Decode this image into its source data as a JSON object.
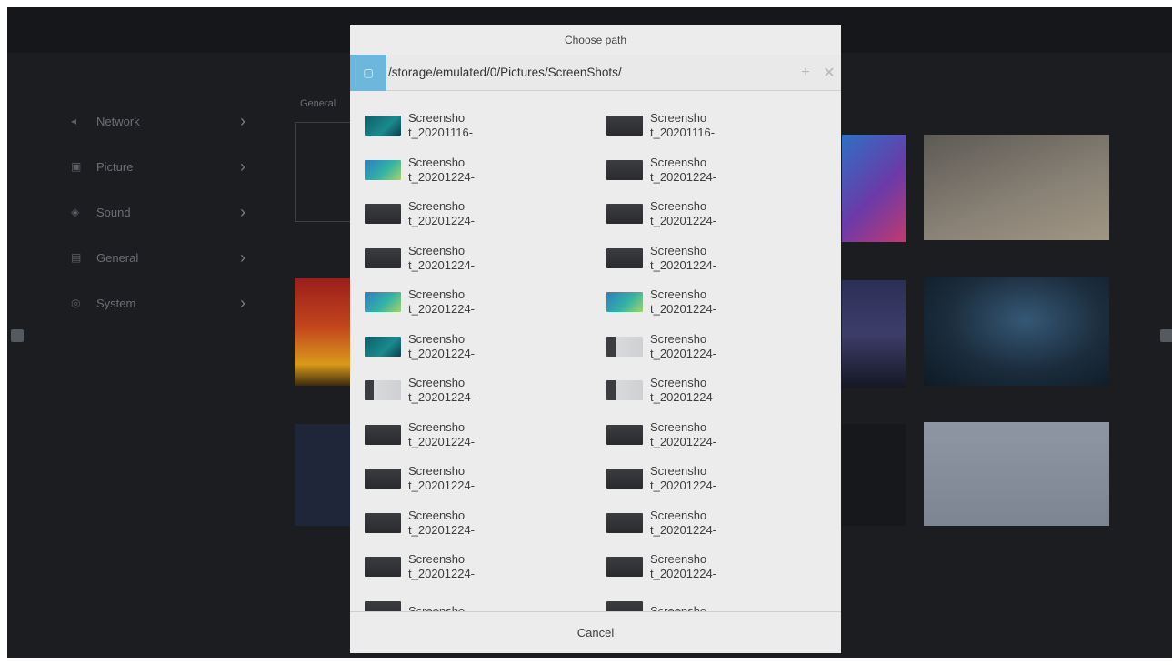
{
  "settings": {
    "nav_items": [
      {
        "label": "Network",
        "icon": "network-icon"
      },
      {
        "label": "Picture",
        "icon": "picture-icon"
      },
      {
        "label": "Sound",
        "icon": "sound-icon"
      },
      {
        "label": "General",
        "icon": "general-icon"
      },
      {
        "label": "System",
        "icon": "system-icon"
      }
    ],
    "section_label": "General",
    "chevron": "›"
  },
  "dialog": {
    "title": "Choose path",
    "path": "/storage/emulated/0/Pictures/ScreenShots/",
    "add_icon": "+",
    "close_icon": "✕",
    "cancel_label": "Cancel",
    "files": [
      {
        "name_line1": "Screensho",
        "name_line2": "t_20201116-",
        "thumb": "teal"
      },
      {
        "name_line1": "Screensho",
        "name_line2": "t_20201116-",
        "thumb": "dark"
      },
      {
        "name_line1": "Screensho",
        "name_line2": "t_20201224-",
        "thumb": "gradient"
      },
      {
        "name_line1": "Screensho",
        "name_line2": "t_20201224-",
        "thumb": "dark"
      },
      {
        "name_line1": "Screensho",
        "name_line2": "t_20201224-",
        "thumb": "dark"
      },
      {
        "name_line1": "Screensho",
        "name_line2": "t_20201224-",
        "thumb": "dark"
      },
      {
        "name_line1": "Screensho",
        "name_line2": "t_20201224-",
        "thumb": "dark"
      },
      {
        "name_line1": "Screensho",
        "name_line2": "t_20201224-",
        "thumb": "dark"
      },
      {
        "name_line1": "Screensho",
        "name_line2": "t_20201224-",
        "thumb": "gradient"
      },
      {
        "name_line1": "Screensho",
        "name_line2": "t_20201224-",
        "thumb": "gradient"
      },
      {
        "name_line1": "Screensho",
        "name_line2": "t_20201224-",
        "thumb": "teal"
      },
      {
        "name_line1": "Screensho",
        "name_line2": "t_20201224-",
        "thumb": "light"
      },
      {
        "name_line1": "Screensho",
        "name_line2": "t_20201224-",
        "thumb": "light"
      },
      {
        "name_line1": "Screensho",
        "name_line2": "t_20201224-",
        "thumb": "light"
      },
      {
        "name_line1": "Screensho",
        "name_line2": "t_20201224-",
        "thumb": "dark"
      },
      {
        "name_line1": "Screensho",
        "name_line2": "t_20201224-",
        "thumb": "dark"
      },
      {
        "name_line1": "Screensho",
        "name_line2": "t_20201224-",
        "thumb": "dark"
      },
      {
        "name_line1": "Screensho",
        "name_line2": "t_20201224-",
        "thumb": "dark"
      },
      {
        "name_line1": "Screensho",
        "name_line2": "t_20201224-",
        "thumb": "dark"
      },
      {
        "name_line1": "Screensho",
        "name_line2": "t_20201224-",
        "thumb": "dark"
      },
      {
        "name_line1": "Screensho",
        "name_line2": "t_20201224-",
        "thumb": "dark"
      },
      {
        "name_line1": "Screensho",
        "name_line2": "t_20201224-",
        "thumb": "dark"
      },
      {
        "name_line1": "Screensho",
        "name_line2": "",
        "thumb": "dark"
      },
      {
        "name_line1": "Screensho",
        "name_line2": "",
        "thumb": "dark"
      }
    ]
  },
  "colors": {
    "accent": "#6db6dc",
    "dialog_bg": "#ececed",
    "background": "#1c1d21"
  }
}
